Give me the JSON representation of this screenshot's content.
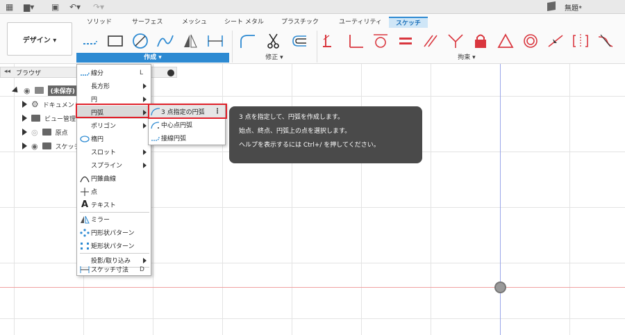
{
  "doc_title": "無題*",
  "design_button": "デザイン ▾",
  "tabs": [
    "ソリッド",
    "サーフェス",
    "メッシュ",
    "シート メタル",
    "プラスチック",
    "ユーティリティ",
    "スケッチ"
  ],
  "groups": {
    "create": "作成 ▾",
    "modify": "修正 ▾",
    "constraints": "拘束 ▾"
  },
  "browser": {
    "title": "ブラウザ",
    "root": "(未保存)",
    "items": [
      "ドキュメント設定",
      "ビュー管理",
      "原点",
      "スケッチ"
    ]
  },
  "menu": {
    "items": [
      {
        "label": "線分",
        "shortcut": "L"
      },
      {
        "label": "長方形"
      },
      {
        "label": "円"
      },
      {
        "label": "円弧"
      },
      {
        "label": "ポリゴン"
      },
      {
        "label": "楕円"
      },
      {
        "label": "スロット"
      },
      {
        "label": "スプライン"
      },
      {
        "label": "円錐曲線"
      },
      {
        "label": "点"
      },
      {
        "label": "テキスト"
      },
      {
        "label": "ミラー"
      },
      {
        "label": "円形状パターン"
      },
      {
        "label": "矩形状パターン"
      },
      {
        "label": "投影/取り込み"
      },
      {
        "label": "スケッチ寸法",
        "shortcut": "D"
      }
    ]
  },
  "submenu": [
    "3 点指定の円弧",
    "中心点円弧",
    "接線円弧"
  ],
  "tooltip": {
    "line1": "3 点を指定して、円弧を作成します。",
    "line2": "始点、終点、円弧上の点を選択します。",
    "line3": "ヘルプを表示するには Ctrl+/ を押してください。"
  },
  "colors": {
    "accent": "#2d8ad2",
    "highlight": "#e0202a",
    "constraint": "#d9363e"
  }
}
